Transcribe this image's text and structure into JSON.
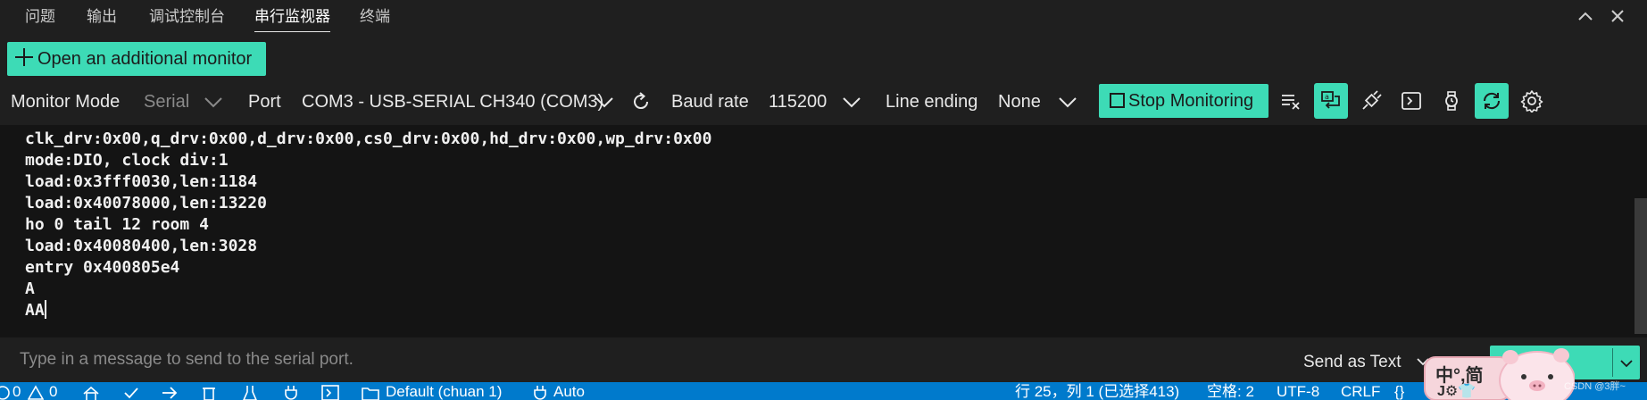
{
  "tabs": [
    "问题",
    "输出",
    "调试控制台",
    "串行监视器",
    "终端"
  ],
  "active_tab": 3,
  "open_monitor": {
    "label": "Open an additional monitor",
    "icon": "plus-icon"
  },
  "toolbar": {
    "monitor_mode_label": "Monitor Mode",
    "monitor_mode_value": "Serial",
    "port_label": "Port",
    "port_value": "COM3 - USB-SERIAL CH340 (COM3)",
    "baud_label": "Baud rate",
    "baud_value": "115200",
    "line_ending_label": "Line ending",
    "line_ending_value": "None",
    "stop_label": "Stop Monitoring"
  },
  "output": {
    "lines": [
      "clk_drv:0x00,q_drv:0x00,d_drv:0x00,cs0_drv:0x00,hd_drv:0x00,wp_drv:0x00",
      "mode:DIO, clock div:1",
      "load:0x3fff0030,len:1184",
      "load:0x40078000,len:13220",
      "ho 0 tail 12 room 4",
      "load:0x40080400,len:3028",
      "entry 0x400805e4",
      "A",
      "AA"
    ]
  },
  "input": {
    "placeholder": "Type in a message to send to the serial port.",
    "send_as": "Send as Text"
  },
  "statusbar": {
    "errors": "0",
    "warnings": "0",
    "profile": "Default (chuan 1)",
    "auto": "Auto",
    "cursor": "行 25，列 1 (已选择413)",
    "spaces": "空格: 2",
    "encoding": "UTF-8",
    "eol": "CRLF",
    "braces": "{}"
  },
  "sticker": {
    "text_top": "中°,简",
    "text_bottom": "J⚙👕"
  },
  "watermark": "CSDN @3胖~",
  "colors": {
    "accent": "#3ddbb6",
    "statusbar": "#007acc",
    "background": "#1f1f1f",
    "output_bg": "#141414"
  }
}
